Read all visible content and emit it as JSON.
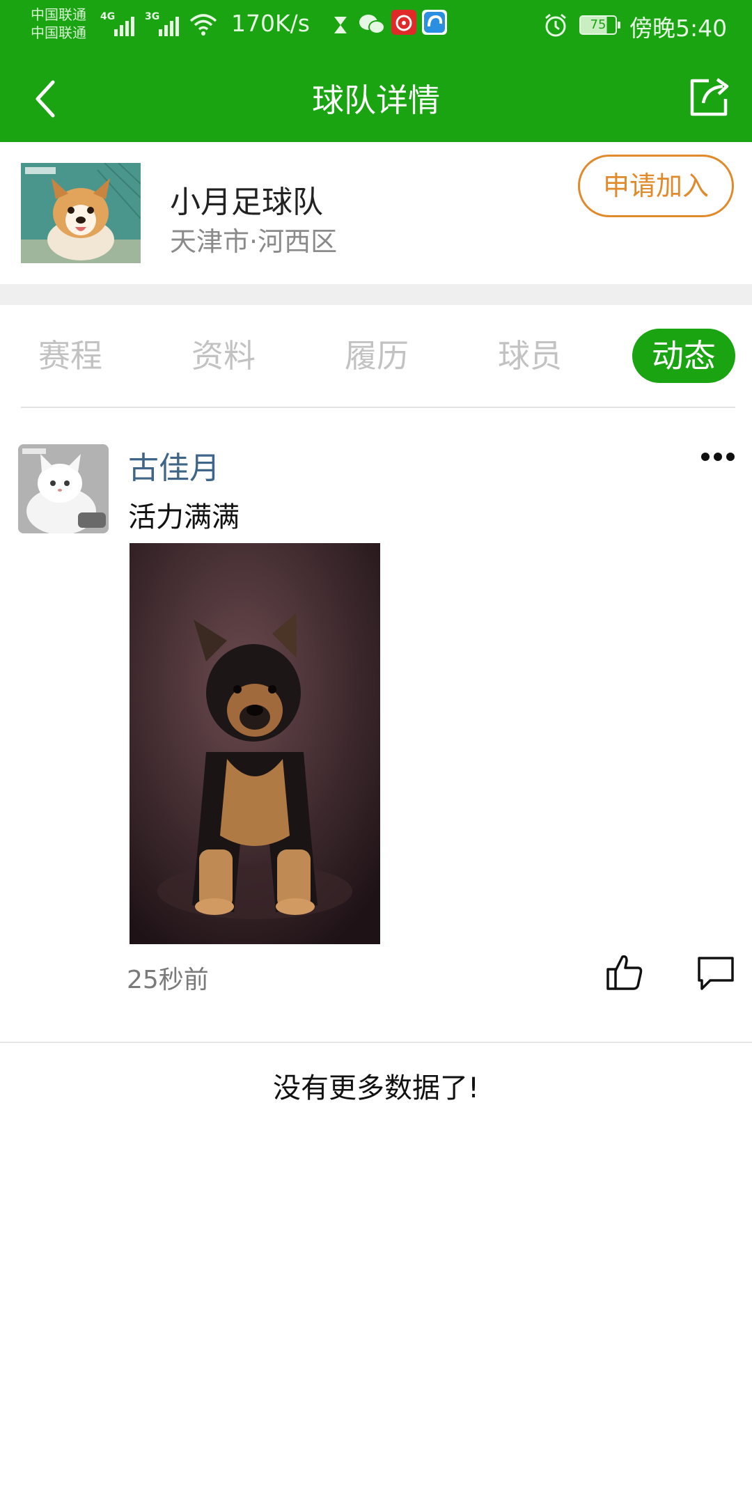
{
  "status_bar": {
    "carrier_1": "中国联通",
    "carrier_2": "中国联通",
    "net_1": "4G",
    "net_2": "3G",
    "speed": "170K/s",
    "battery": "75",
    "time": "傍晚5:40",
    "icons": [
      "signal-icon",
      "wifi-icon",
      "hourglass-icon",
      "wechat-icon",
      "netease-music-icon",
      "app-icon",
      "alarm-icon",
      "battery-icon"
    ]
  },
  "nav": {
    "title": "球队详情",
    "back_icon": "chevron-left-icon",
    "share_icon": "share-icon"
  },
  "team": {
    "name": "小月足球队",
    "location": "天津市·河西区",
    "join_label": "申请加入"
  },
  "tabs": [
    {
      "label": "赛程",
      "active": false
    },
    {
      "label": "资料",
      "active": false
    },
    {
      "label": "履历",
      "active": false
    },
    {
      "label": "球员",
      "active": false
    },
    {
      "label": "动态",
      "active": true
    }
  ],
  "post": {
    "user": "古佳月",
    "text": "活力满满",
    "time": "25秒前",
    "more_icon": "more-icon",
    "like_icon": "thumbs-up-icon",
    "comment_icon": "comment-icon"
  },
  "footer_text": "没有更多数据了!",
  "colors": {
    "primary_green": "#1aa412",
    "join_orange": "#e08a2c",
    "username_blue": "#3f6688"
  }
}
